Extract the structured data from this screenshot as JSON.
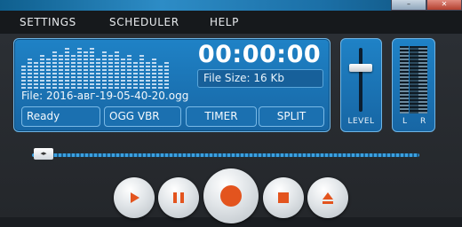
{
  "menu": {
    "settings": "SETTINGS",
    "scheduler": "SCHEDULER",
    "help": "HELP"
  },
  "display": {
    "time": "00:00:00",
    "file_size": "File Size: 16 Kb",
    "file_name": "File:  2016-авг-19-05-40-20.ogg",
    "status": "Ready",
    "format": "OGG  VBR",
    "timer_label": "TIMER",
    "split_label": "SPLIT"
  },
  "level": {
    "label": "LEVEL",
    "value": 0.7
  },
  "vu": {
    "left_label": "L",
    "right_label": "R"
  },
  "seek": {
    "position": 0.0,
    "thumb_glyph": "◂▸"
  },
  "transport": {
    "play_icon": "play-icon",
    "pause_icon": "pause-icon",
    "record_icon": "record-icon",
    "stop_icon": "stop-icon",
    "eject_icon": "eject-icon"
  },
  "colors": {
    "accent": "#1b6fb0",
    "panel_border": "#6fb4e4",
    "icon_orange": "#e3541e"
  }
}
